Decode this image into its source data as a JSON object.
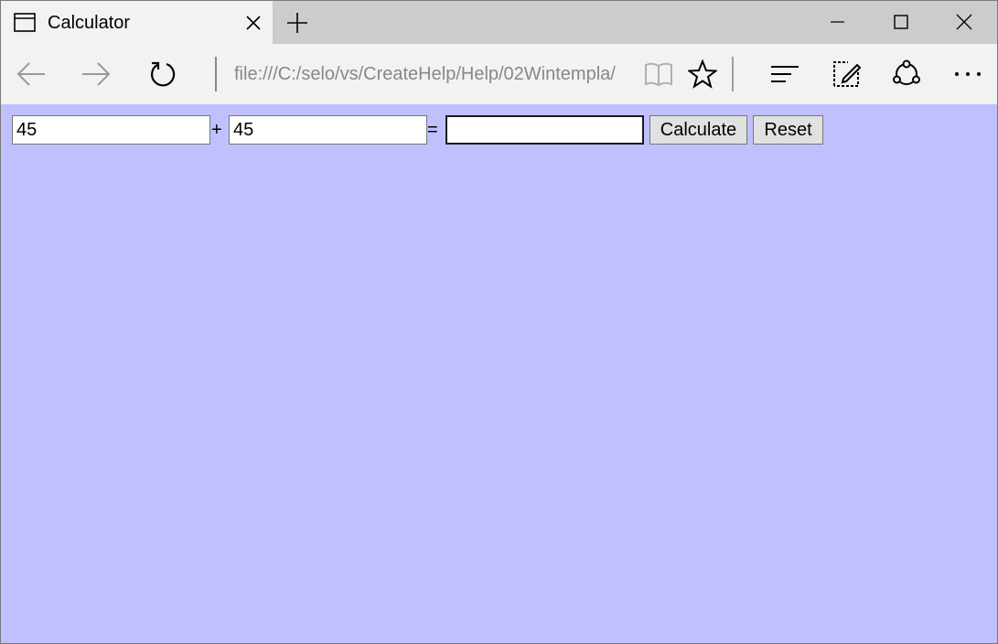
{
  "window": {
    "tab_title": "Calculator",
    "controls": [
      "minimize",
      "maximize",
      "close"
    ]
  },
  "navbar": {
    "address": "file:///C:/selo/vs/CreateHelp/Help/02Wintempla/",
    "icons": [
      "back-icon",
      "forward-icon",
      "refresh-icon",
      "reading-view-icon",
      "favorite-star-icon",
      "hub-icon",
      "web-note-icon",
      "share-icon",
      "more-icon"
    ]
  },
  "calculator": {
    "operand1_value": "45",
    "plus_label": "+",
    "operand2_value": "45",
    "equals_label": "=",
    "result_value": "",
    "calculate_label": "Calculate",
    "reset_label": "Reset"
  },
  "colors": {
    "page_background": "#c0c0ff",
    "chrome": "#f2f2f2",
    "titlebar": "#cccccc"
  }
}
